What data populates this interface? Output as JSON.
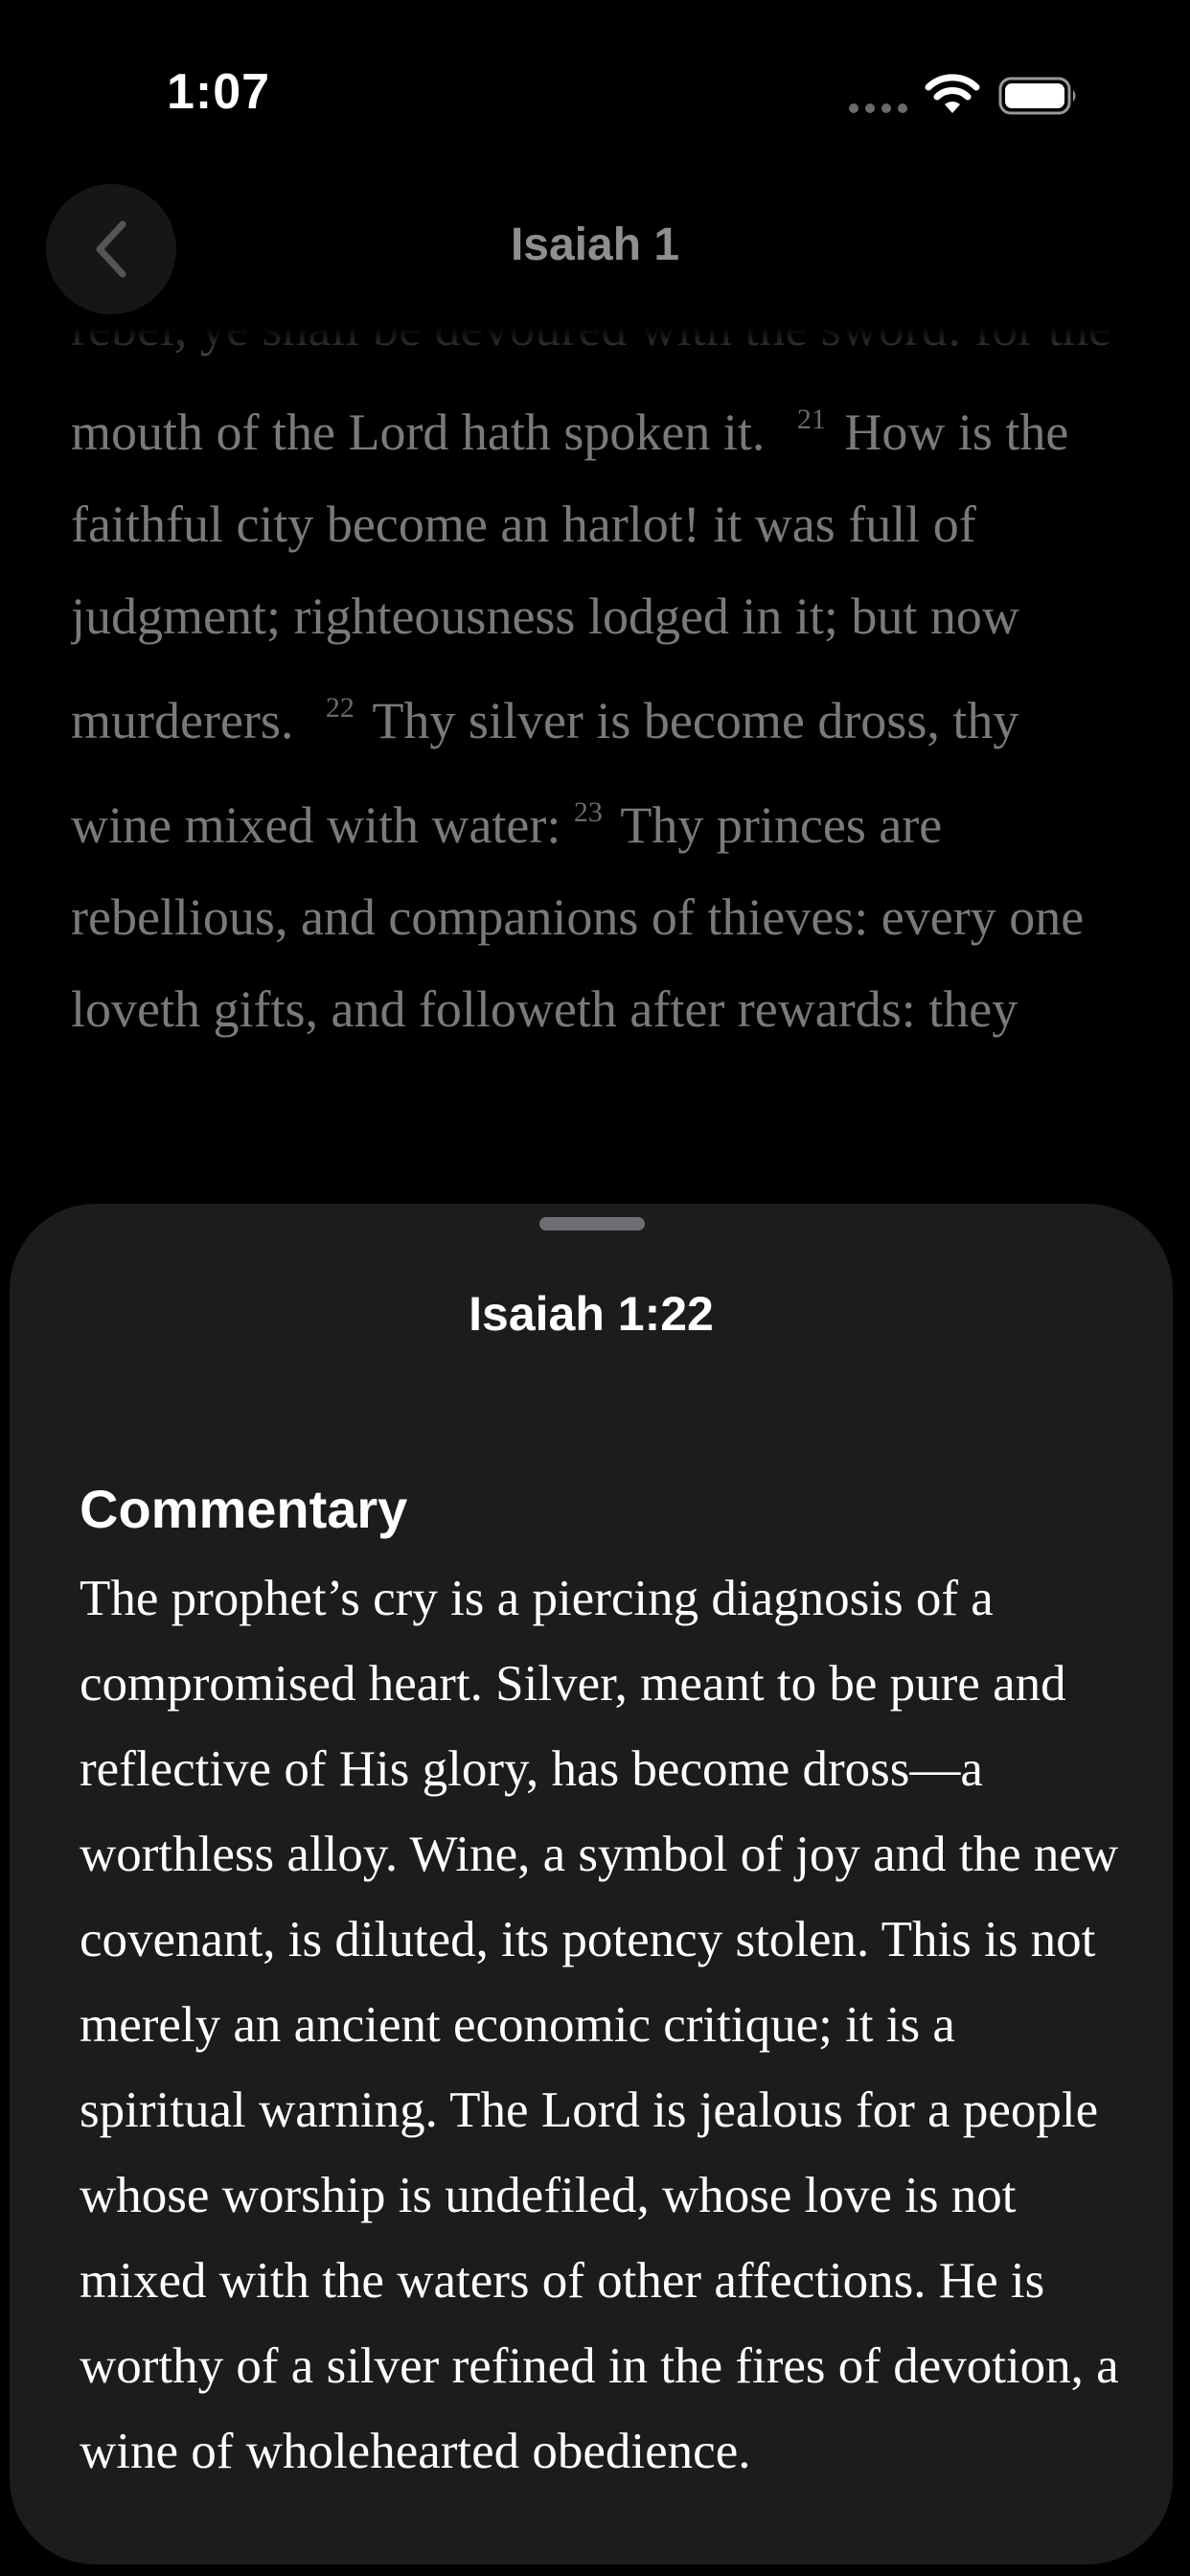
{
  "status_bar": {
    "time": "1:07"
  },
  "nav": {
    "title": "Isaiah 1",
    "back_icon": "chevron-left-icon"
  },
  "scripture": {
    "text_start": "rebel, ye shall be devoured with the sword: for the mouth of the Lord hath spoken it.",
    "verse_21_number": "21",
    "verse_21_text": "How is the faithful city become an harlot! it was full of judgment; righteousness lodged in it; but now murderers.",
    "verse_22_number": "22",
    "verse_22_text": "Thy silver is become dross, thy wine mixed with water:",
    "verse_23_number": "23",
    "verse_23_text": "Thy princes are rebellious, and companions of thieves: every one loveth gifts, and followeth after rewards: they"
  },
  "sheet": {
    "title": "Isaiah 1:22",
    "section_heading": "Commentary",
    "commentary": "The prophet’s cry is a piercing diagnosis of a compromised heart. Silver, meant to be pure and reflective of His glory, has become dross—a worthless alloy. Wine, a symbol of joy and the new covenant, is diluted, its potency stolen. This is not merely an ancient economic critique; it is a spiritual warning. The Lord is jealous for a people whose worship is undefiled, whose love is not mixed with the waters of other affections. He is worthy of a silver refined in the fires of devotion, a wine of wholehearted obedience."
  }
}
